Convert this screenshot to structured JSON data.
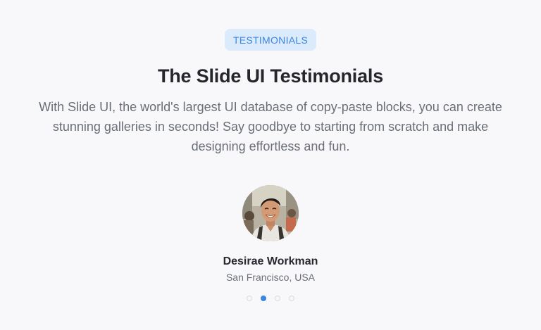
{
  "badge": "TESTIMONIALS",
  "title": "The Slide UI Testimonials",
  "description": "With Slide UI, the world's largest UI database of copy-paste blocks, you can create stunning galleries in seconds! Say goodbye to starting from scratch and make designing effortless and fun.",
  "testimonial": {
    "name": "Desirae Workman",
    "location": "San Francisco, USA"
  },
  "pagination": {
    "total": 4,
    "active_index": 2
  },
  "colors": {
    "accent": "#3b86df",
    "badge_bg": "#dcebfc",
    "background": "#f8f8fa"
  }
}
